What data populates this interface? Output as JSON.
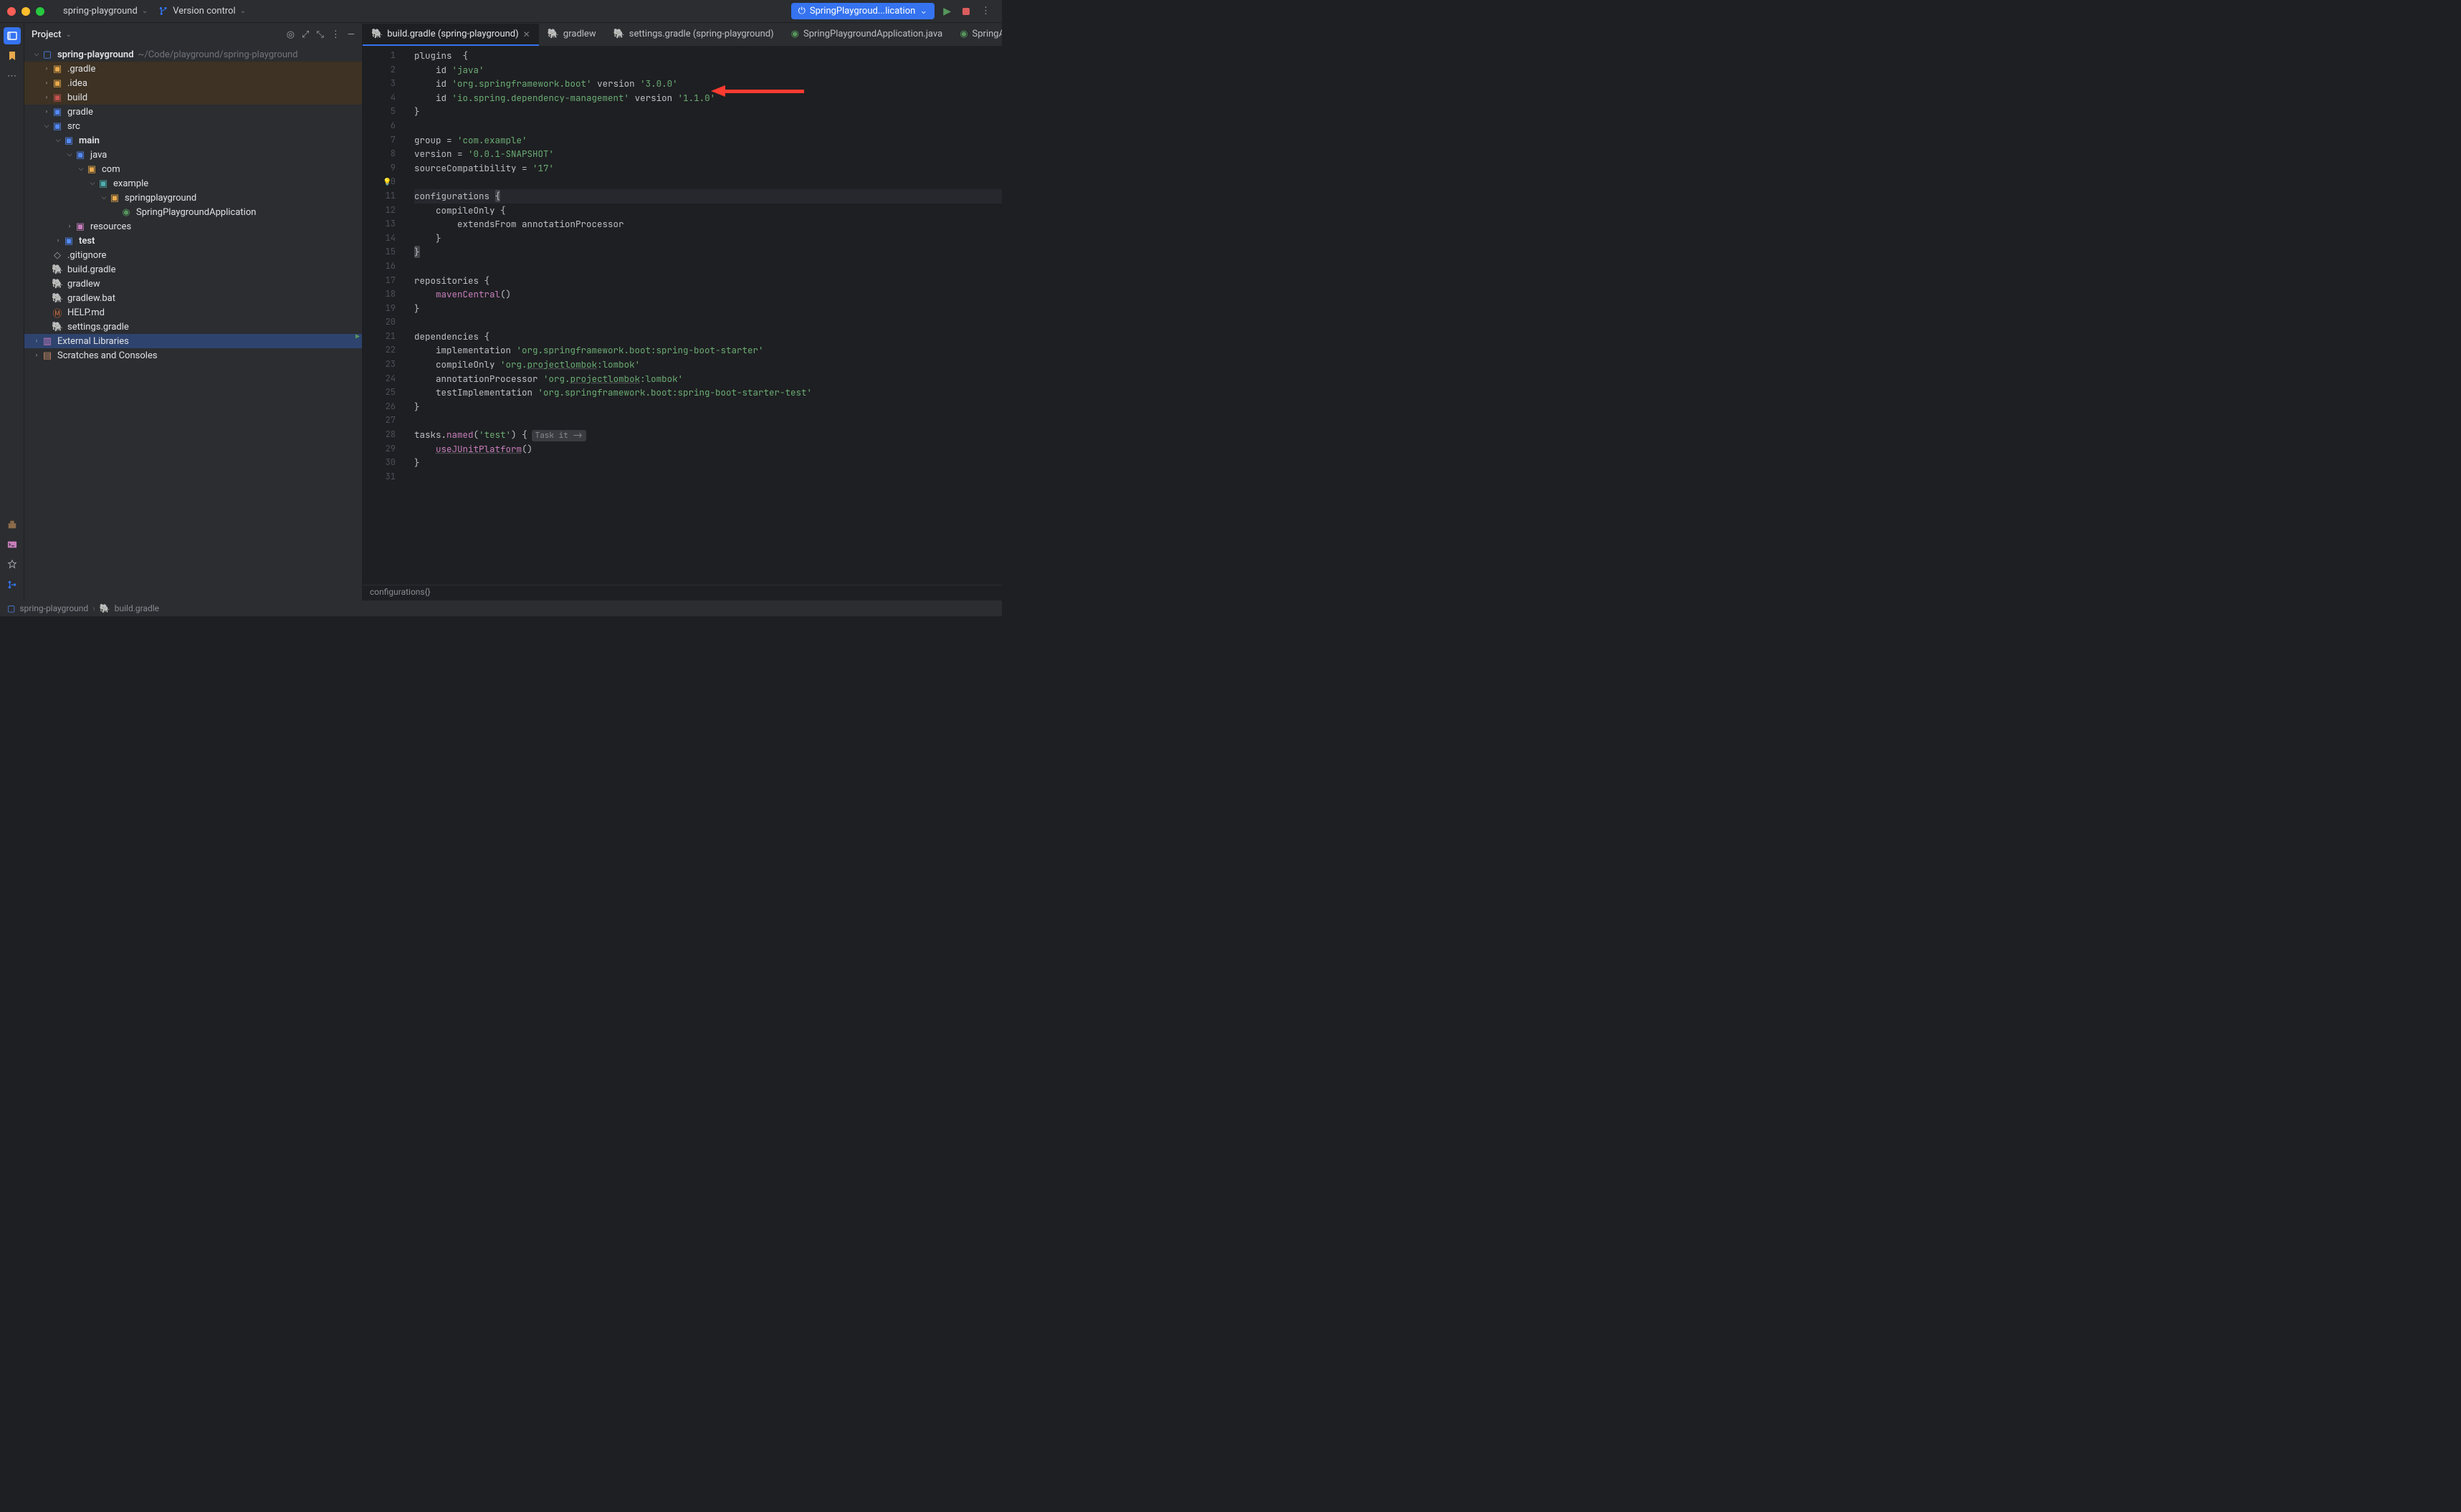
{
  "titlebar": {
    "project_name": "spring-playground",
    "vcs_label": "Version control",
    "run_config_label": "SpringPlaygroud...lication"
  },
  "panel": {
    "title": "Project"
  },
  "tree": {
    "root_name": "spring-playground",
    "root_path": "~/Code/playground/spring-playground",
    "gradle_dir": ".gradle",
    "idea_dir": ".idea",
    "build_dir": "build",
    "gradle_folder": "gradle",
    "src": "src",
    "main": "main",
    "java": "java",
    "com": "com",
    "example": "example",
    "springplayground": "springplayground",
    "app_class": "SpringPlaygroundApplication",
    "resources": "resources",
    "test": "test",
    "gitignore": ".gitignore",
    "build_gradle": "build.gradle",
    "gradlew": "gradlew",
    "gradlew_bat": "gradlew.bat",
    "help_md": "HELP.md",
    "settings_gradle": "settings.gradle",
    "external_libs": "External Libraries",
    "scratches": "Scratches and Consoles"
  },
  "tabs": [
    {
      "label": "build.gradle (spring-playground)",
      "active": true,
      "closable": true,
      "icon": "gradle"
    },
    {
      "label": "gradlew",
      "active": false,
      "closable": false,
      "icon": "gradle"
    },
    {
      "label": "settings.gradle (spring-playground)",
      "active": false,
      "closable": false,
      "icon": "gradle"
    },
    {
      "label": "SpringPlaygroundApplication.java",
      "active": false,
      "closable": false,
      "icon": "java"
    },
    {
      "label": "SpringApplication.java",
      "active": false,
      "closable": false,
      "icon": "java"
    }
  ],
  "code": {
    "lines": [
      {
        "n": 1,
        "html": "<span class='kw'>plugins</span>  <span class='kw'>{</span>"
      },
      {
        "n": 2,
        "html": "    <span class='kw'>id</span> <span class='str'>'java'</span>"
      },
      {
        "n": 3,
        "html": "    <span class='kw'>id</span> <span class='str'>'org.springframework.boot'</span> <span class='kw'>version</span> <span class='str'>'3.0.0'</span>"
      },
      {
        "n": 4,
        "html": "    <span class='kw'>id</span> <span class='str'>'io.spring.dependency-management'</span> <span class='kw'>version</span> <span class='str'>'1.1.0'</span>"
      },
      {
        "n": 5,
        "html": "<span class='kw'>}</span>"
      },
      {
        "n": 6,
        "html": ""
      },
      {
        "n": 7,
        "html": "<span class='kw'>group</span> = <span class='str'>'com.example'</span>"
      },
      {
        "n": 8,
        "html": "<span class='kw'>version</span> = <span class='str'>'0.0.1-SNAPSHOT'</span>"
      },
      {
        "n": 9,
        "html": "<span class='kw'>sourceCompatibility</span> = <span class='str'>'17'</span>"
      },
      {
        "n": 10,
        "html": "",
        "bulb": true
      },
      {
        "n": 11,
        "html": "<span class='kw'>configurations</span> <span class='brace-hl'>{</span>",
        "hl": true
      },
      {
        "n": 12,
        "html": "    <span class='kw'>compileOnly</span> {"
      },
      {
        "n": 13,
        "html": "        <span class='kw'>extendsFrom</span> <span class='id'>annotationProcessor</span>"
      },
      {
        "n": 14,
        "html": "    }"
      },
      {
        "n": 15,
        "html": "<span class='brace-hl'>}</span>"
      },
      {
        "n": 16,
        "html": ""
      },
      {
        "n": 17,
        "html": "<span class='kw'>repositories</span> {"
      },
      {
        "n": 18,
        "html": "    <span class='fn'>mavenCentral</span>()"
      },
      {
        "n": 19,
        "html": "}"
      },
      {
        "n": 20,
        "html": ""
      },
      {
        "n": 21,
        "html": "<span class='kw'>dependencies</span> {",
        "run": true
      },
      {
        "n": 22,
        "html": "    <span class='kw'>implementation</span> <span class='str'>'org.springframework.boot:spring-boot-starter'</span>"
      },
      {
        "n": 23,
        "html": "    <span class='kw'>compileOnly</span> <span class='str'>'org.</span><span class='str underline'>projectlombok</span><span class='str'>:lombok'</span>"
      },
      {
        "n": 24,
        "html": "    <span class='kw'>annotationProcessor</span> <span class='str'>'org.</span><span class='str underline'>projectlombok</span><span class='str'>:lombok'</span>"
      },
      {
        "n": 25,
        "html": "    <span class='kw'>testImplementation</span> <span class='str'>'org.springframework.boot:spring-boot-starter-test'</span>"
      },
      {
        "n": 26,
        "html": "}"
      },
      {
        "n": 27,
        "html": ""
      },
      {
        "n": 28,
        "html": "<span class='id'>tasks</span>.<span class='fn'>named</span>(<span class='str'>'test'</span>) {<span class='inlay'>Task it -&gt;</span>"
      },
      {
        "n": 29,
        "html": "    <span class='fn underline'>useJUnitPlatform</span>()"
      },
      {
        "n": 30,
        "html": "}"
      },
      {
        "n": 31,
        "html": ""
      }
    ]
  },
  "editor_status": "configurations{}",
  "breadcrumb": {
    "project": "spring-playground",
    "file": "build.gradle"
  }
}
